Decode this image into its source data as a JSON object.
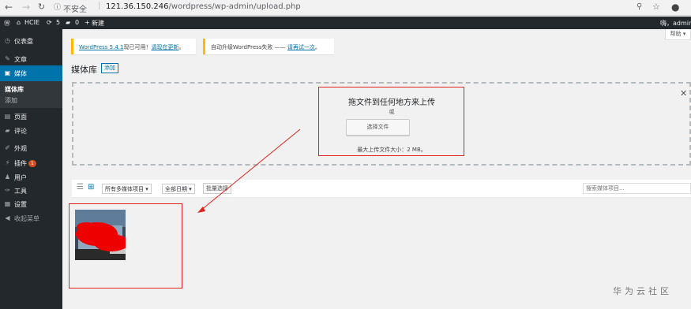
{
  "browser": {
    "security_label": "不安全",
    "url_host": "121.36.150.246",
    "url_path": "/wordpress/wp-admin/upload.php"
  },
  "adminbar": {
    "site_name": "HCIE",
    "updates_count": "5",
    "comments_count": "0",
    "new_label": "新建",
    "greeting": "嗨，admin"
  },
  "sidebar": {
    "items": [
      {
        "label": "仪表盘",
        "icon": "dashboard-icon"
      },
      {
        "label": "文章",
        "icon": "pin-icon"
      },
      {
        "label": "媒体",
        "icon": "media-icon"
      },
      {
        "label": "页面",
        "icon": "page-icon"
      },
      {
        "label": "评论",
        "icon": "comment-icon"
      },
      {
        "label": "外观",
        "icon": "appearance-icon"
      },
      {
        "label": "插件",
        "icon": "plugin-icon",
        "badge": "1"
      },
      {
        "label": "用户",
        "icon": "users-icon"
      },
      {
        "label": "工具",
        "icon": "tools-icon"
      },
      {
        "label": "设置",
        "icon": "settings-icon"
      },
      {
        "label": "收起菜单",
        "icon": "collapse-icon"
      }
    ],
    "submenu": [
      {
        "label": "媒体库"
      },
      {
        "label": "添加"
      }
    ]
  },
  "help_tab": "帮助",
  "notices": {
    "update_link": "WordPress 5.4.1",
    "update_text": "现已可用！",
    "update_now": "请现在更新",
    "update_end": "。",
    "auto_fail_text": "自动升级WordPress失败 —— ",
    "retry_link": "请再试一次",
    "retry_end": "。"
  },
  "page": {
    "title": "媒体库",
    "add_new": "添加"
  },
  "uploader": {
    "drop_text": "拖文件到任何地方来上传",
    "or_text": "或",
    "select_button": "选择文件",
    "max_size": "最大上传文件大小：2 MB。"
  },
  "toolbar": {
    "filter_type": "所有多媒体项目",
    "filter_date": "全部日期",
    "bulk_select": "批量选择",
    "search_placeholder": "搜索媒体项目..."
  },
  "watermark": "华为云社区",
  "colors": {
    "admin_dark": "#23282d",
    "accent": "#0073aa",
    "annotation_red": "#e0231c"
  }
}
